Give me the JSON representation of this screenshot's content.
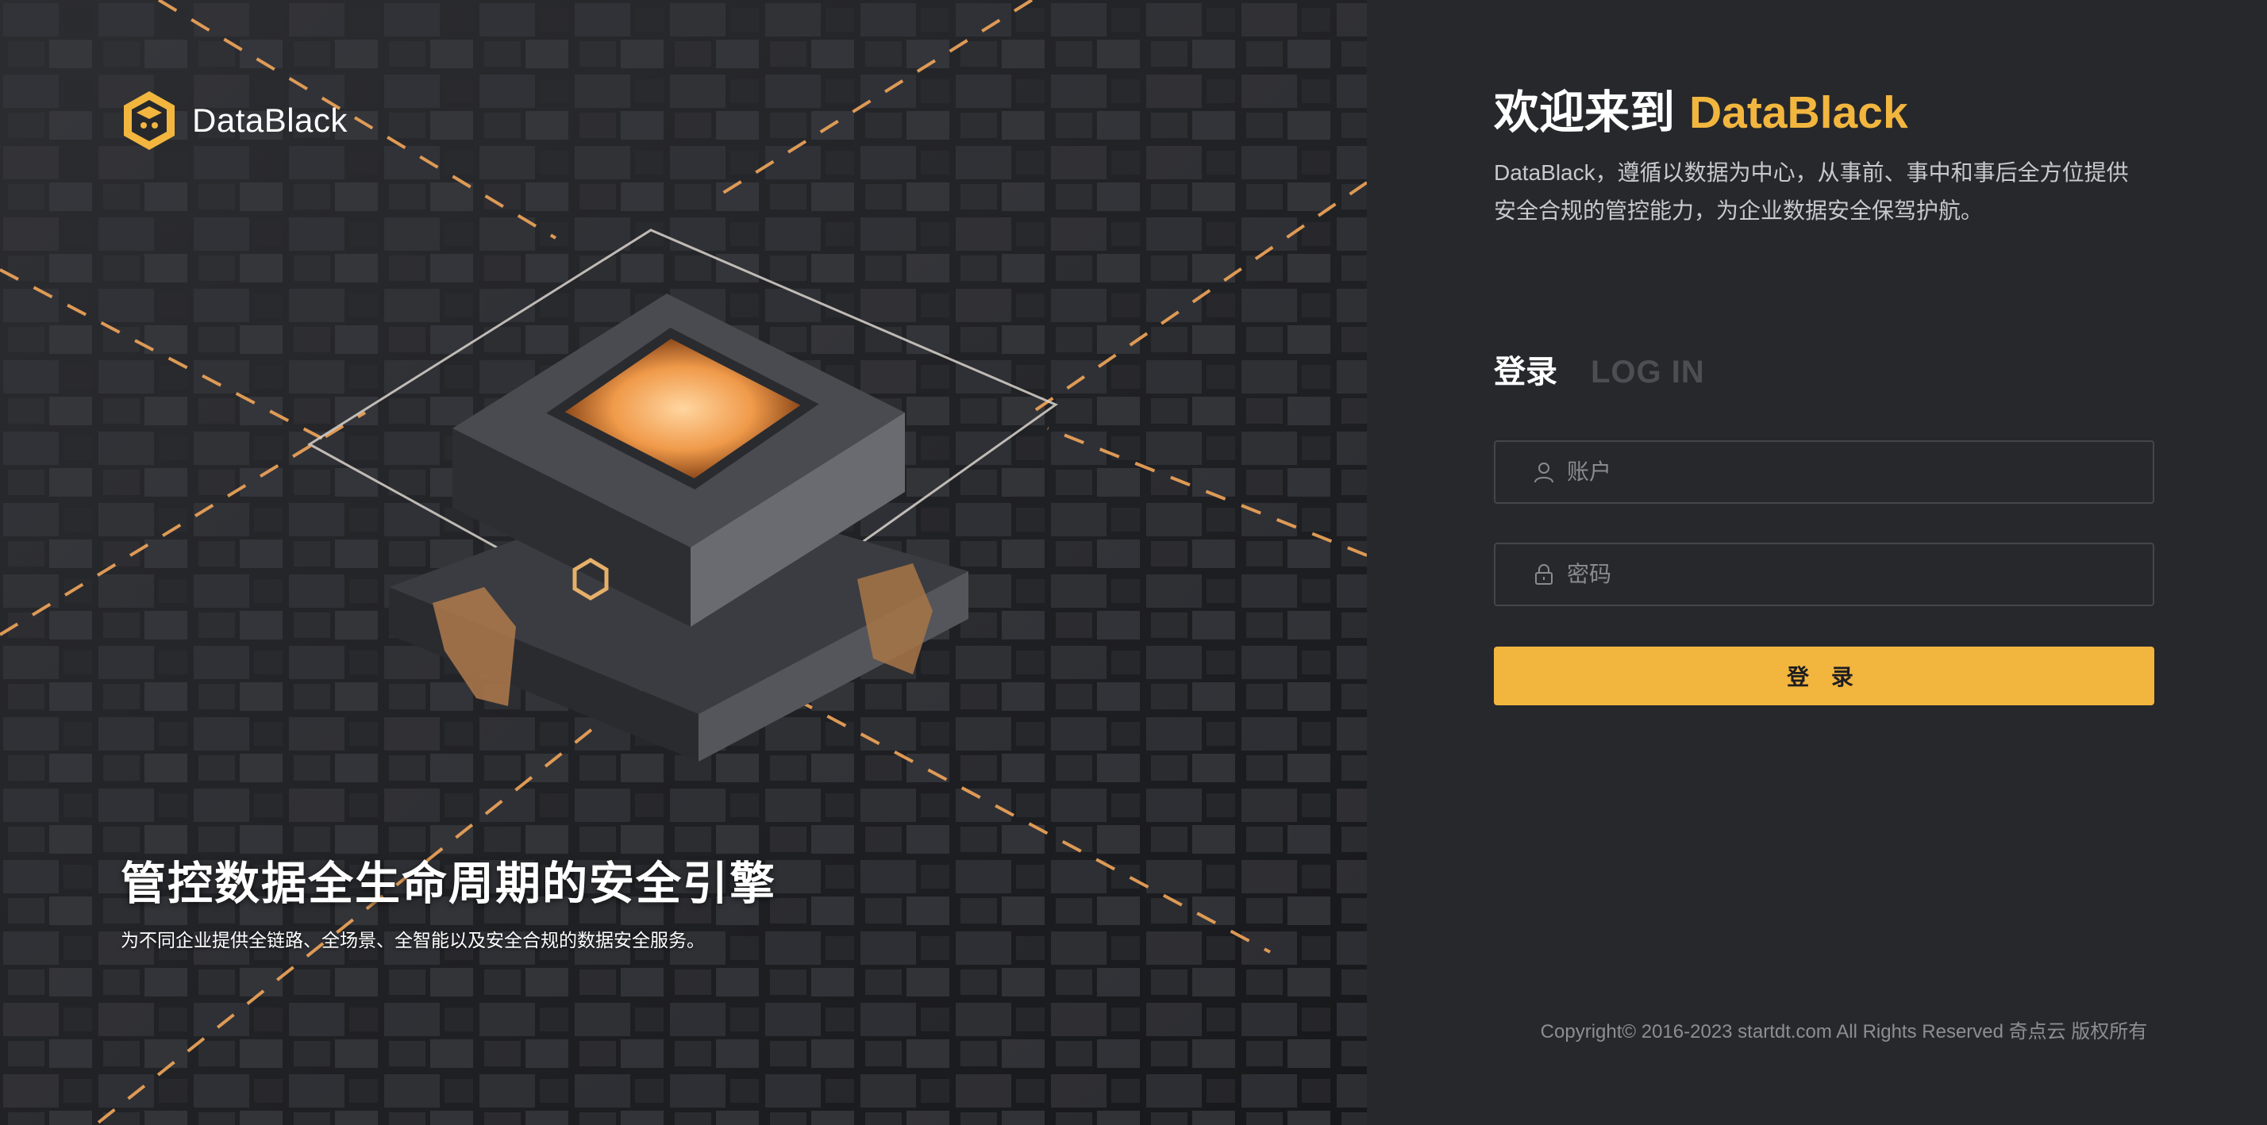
{
  "brand": {
    "name": "DataBlack",
    "logo_icon": "hexagon-cube-icon"
  },
  "hero": {
    "title": "管控数据全生命周期的安全引擎",
    "subtitle": "为不同企业提供全链路、全场景、全智能以及安全合规的数据安全服务。"
  },
  "panel": {
    "welcome_prefix": "欢迎来到",
    "welcome_brand": "DataBlack",
    "description": "DataBlack，遵循以数据为中心，从事前、事中和事后全方位提供安全合规的管控能力，为企业数据安全保驾护航。",
    "tab_active": "登录",
    "tab_inactive": "LOG IN",
    "account_placeholder": "账户",
    "account_icon": "user-icon",
    "password_placeholder": "密码",
    "password_icon": "lock-icon",
    "login_button": "登 录",
    "copyright": "Copyright© 2016-2023 startdt.com All Rights Reserved 奇点云 版权所有"
  },
  "colors": {
    "accent": "#f2b63f",
    "panel_bg": "#27282c",
    "text_muted": "#8d8e93"
  }
}
